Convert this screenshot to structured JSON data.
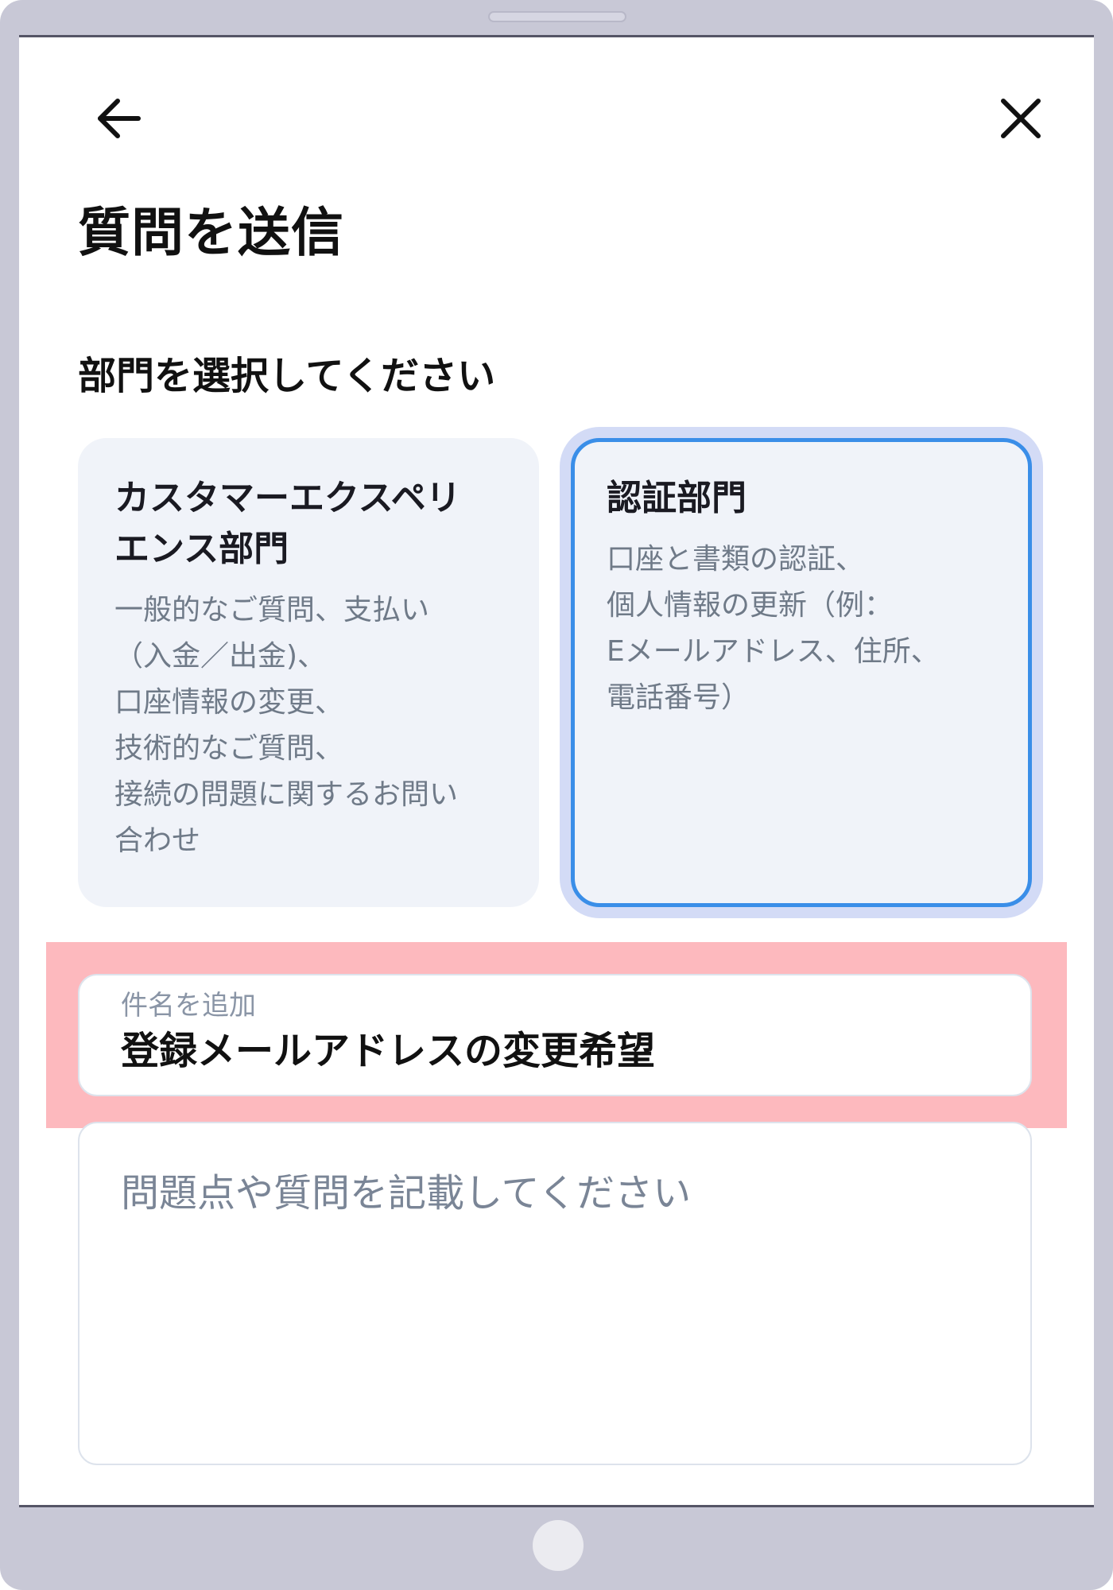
{
  "header": {
    "back_icon": "arrow-left-icon",
    "close_icon": "close-icon"
  },
  "page": {
    "title": "質問を送信",
    "section_heading": "部門を選択してください"
  },
  "departments": [
    {
      "title_lines": [
        "カスタマーエクスペリ",
        "エンス部門"
      ],
      "desc_lines": [
        "一般的なご質問、支払い",
        "（入金／出金)、",
        "口座情報の変更、",
        "技術的なご質問、",
        "接続の問題に関するお問い",
        "合わせ"
      ],
      "selected": false
    },
    {
      "title_lines": [
        "認証部門"
      ],
      "desc_lines": [
        "口座と書類の認証、",
        "個人情報の更新（例：",
        "Eメールアドレス、住所、",
        "電話番号）"
      ],
      "selected": true
    }
  ],
  "subject": {
    "label": "件名を追加",
    "value": "登録メールアドレスの変更希望"
  },
  "message": {
    "placeholder": "問題点や質問を記載してください"
  },
  "colors": {
    "accent_border": "#3a8ee8",
    "selected_glow": "#d3dbf6",
    "card_bg": "#f0f3f9",
    "highlight": "#fdb9be",
    "device_frame": "#c8c8d6"
  }
}
